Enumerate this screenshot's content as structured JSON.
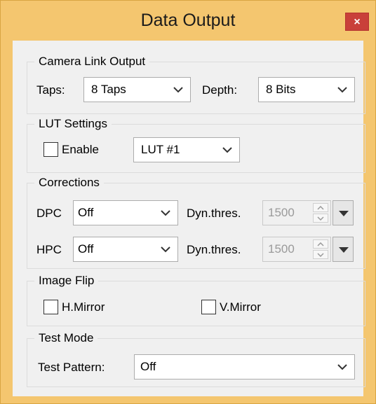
{
  "window": {
    "title": "Data Output",
    "close_glyph": "×"
  },
  "camera_link": {
    "group_title": "Camera Link Output",
    "taps_label": "Taps:",
    "taps_value": "8 Taps",
    "depth_label": "Depth:",
    "depth_value": "8 Bits"
  },
  "lut": {
    "group_title": "LUT Settings",
    "enable_label": "Enable",
    "enable_checked": false,
    "lut_value": "LUT #1"
  },
  "corrections": {
    "group_title": "Corrections",
    "dpc_label": "DPC",
    "dpc_value": "Off",
    "dpc_thres_label": "Dyn.thres.",
    "dpc_thres_value": "1500",
    "hpc_label": "HPC",
    "hpc_value": "Off",
    "hpc_thres_label": "Dyn.thres.",
    "hpc_thres_value": "1500"
  },
  "image_flip": {
    "group_title": "Image Flip",
    "h_mirror_label": "H.Mirror",
    "h_mirror_checked": false,
    "v_mirror_label": "V.Mirror",
    "v_mirror_checked": false
  },
  "test_mode": {
    "group_title": "Test Mode",
    "pattern_label": "Test Pattern:",
    "pattern_value": "Off"
  },
  "colors": {
    "title_bar": "#f4c66f",
    "close_button": "#c9403a",
    "client_bg": "#f0f0f0"
  }
}
